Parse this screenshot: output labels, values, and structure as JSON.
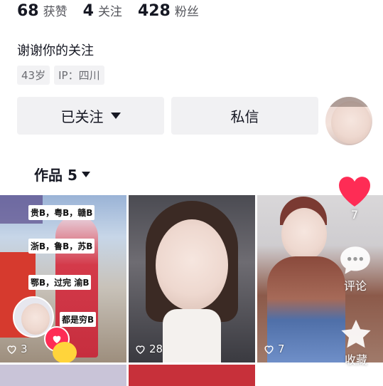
{
  "stats": [
    {
      "num": "68",
      "label": "获赞"
    },
    {
      "num": "4",
      "label": "关注"
    },
    {
      "num": "428",
      "label": "粉丝"
    }
  ],
  "bio": "谢谢你的关注",
  "tags": [
    "43岁",
    "IP：四川"
  ],
  "buttons": {
    "follow": "已关注",
    "message": "私信"
  },
  "works": {
    "label": "作品 5"
  },
  "videos": [
    {
      "likes": "3",
      "overlay": [
        "贵B，粤B，赣B",
        "浙B，鲁B，苏B",
        "鄂B，过完  渝B",
        "都是穷B"
      ]
    },
    {
      "likes": "28"
    },
    {
      "likes": "7"
    }
  ],
  "side_actions": {
    "like_count": "7",
    "comment": "评论",
    "favorite": "收藏"
  },
  "colors": {
    "accent": "#fe2c55",
    "button_bg": "#f1f1f3",
    "tag_bg": "#f2f2f4"
  }
}
